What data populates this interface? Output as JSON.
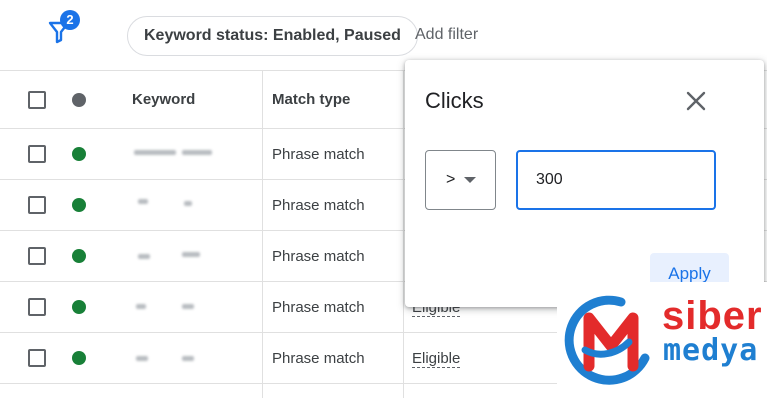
{
  "filter_bar": {
    "filter_count": "2",
    "chip_label": "Keyword status: Enabled, Paused",
    "add_filter_label": "Add filter"
  },
  "table": {
    "headers": {
      "keyword": "Keyword",
      "match_type": "Match type"
    },
    "rows": [
      {
        "match_type": "Phrase match",
        "status": ""
      },
      {
        "match_type": "Phrase match",
        "status": ""
      },
      {
        "match_type": "Phrase match",
        "status": ""
      },
      {
        "match_type": "Phrase match",
        "status": "Eligible"
      },
      {
        "match_type": "Phrase match",
        "status": "Eligible"
      }
    ]
  },
  "clicks_filter": {
    "title": "Clicks",
    "operator": ">",
    "value": "300",
    "apply_label": "Apply"
  },
  "watermark": {
    "line1": "siber",
    "line2": "medya"
  },
  "colors": {
    "primary_blue": "#1a73e8",
    "status_green": "#188038",
    "logo_red": "#e32b2b",
    "logo_blue": "#1f7fd1"
  }
}
